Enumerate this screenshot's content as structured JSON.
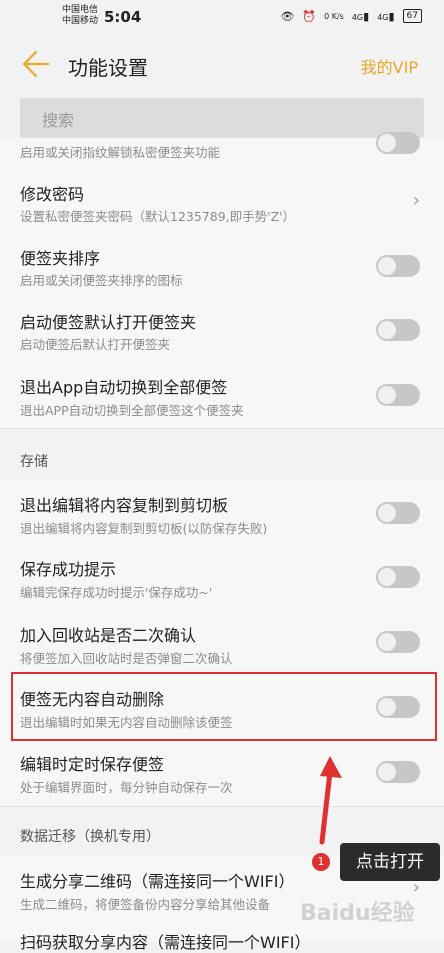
{
  "status_bar": {
    "carrier1": "中国电信",
    "carrier2": "中国移动",
    "time": "5:04",
    "speed": "0 K/s",
    "signal1": "4G",
    "signal2": "4G",
    "battery": "67"
  },
  "header": {
    "back_icon": "back-arrow-icon",
    "title": "功能设置",
    "vip_link": "我的VIP"
  },
  "search": {
    "placeholder": "搜索"
  },
  "partial_top": {
    "subtitle": "启用或关闭指纹解锁私密便签夹功能"
  },
  "settings_security": [
    {
      "title": "修改密码",
      "subtitle": "设置私密便签夹密码（默认1235789,即手势'Z'）",
      "control": "chevron"
    },
    {
      "title": "便签夹排序",
      "subtitle": "启用或关闭便签夹排序的图标",
      "control": "toggle",
      "on": false
    },
    {
      "title": "启动便签默认打开便签夹",
      "subtitle": "启动便签后默认打开便签夹",
      "control": "toggle",
      "on": false
    },
    {
      "title": "退出App自动切换到全部便签",
      "subtitle": "退出APP自动切换到全部便签这个便签夹",
      "control": "toggle",
      "on": false
    }
  ],
  "section_storage": "存储",
  "settings_storage": [
    {
      "title": "退出编辑将内容复制到剪切板",
      "subtitle": "退出编辑将内容复制到剪切板(以防保存失败)",
      "on": false
    },
    {
      "title": "保存成功提示",
      "subtitle": "编辑完保存成功时提示'保存成功~'",
      "on": false
    },
    {
      "title": "加入回收站是否二次确认",
      "subtitle": "将便签加入回收站时是否弹窗二次确认",
      "on": false
    },
    {
      "title": "便签无内容自动删除",
      "subtitle": "退出编辑时如果无内容自动删除该便签",
      "on": false
    },
    {
      "title": "编辑时定时保存便签",
      "subtitle": "处于编辑界面时，每分钟自动保存一次",
      "on": false
    }
  ],
  "section_migration": "数据迁移（换机专用）",
  "settings_migration": [
    {
      "title": "生成分享二维码（需连接同一个WIFI）",
      "subtitle": "生成二维码，将便签备份内容分享给其他设备",
      "control": "chevron"
    },
    {
      "title": "扫码获取分享内容（需连接同一个WIFI）"
    }
  ],
  "annotation": {
    "step_number": "1",
    "tooltip": "点击打开",
    "highlight_color": "#e03131"
  },
  "watermark": "Baidu经验",
  "colors": {
    "accent": "#e9a927",
    "background": "#f2f2f2"
  }
}
